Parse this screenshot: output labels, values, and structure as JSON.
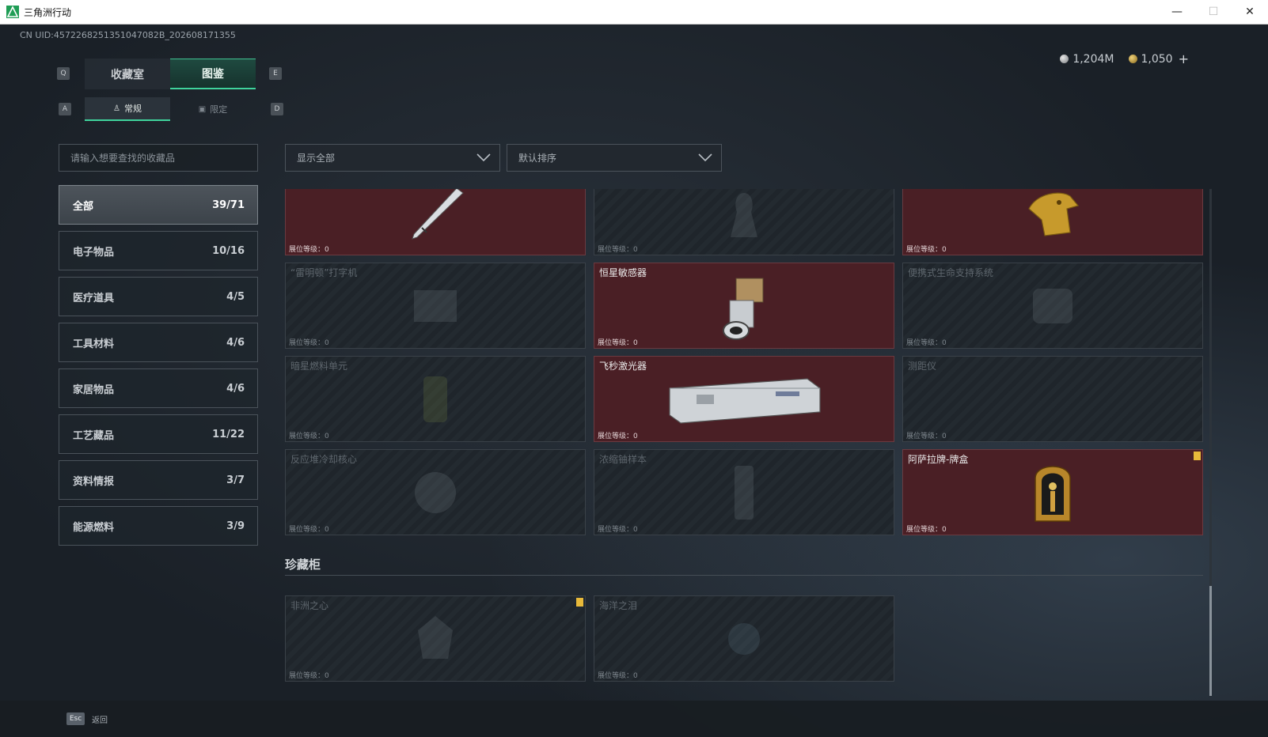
{
  "window": {
    "title": "三角洲行动",
    "minimize": "—",
    "maximize": "☐",
    "close": "✕"
  },
  "uid": "CN UID:4572268251351047082B_202608171355",
  "currency": {
    "silver": "1,204M",
    "gold": "1,050",
    "plus": "+"
  },
  "keys": {
    "q": "Q",
    "e": "E",
    "a": "A",
    "d": "D",
    "esc": "Esc"
  },
  "main_tabs": [
    "收藏室",
    "图鉴"
  ],
  "sub_tabs": [
    "常规",
    "限定"
  ],
  "search": {
    "placeholder": "请输入想要查找的收藏品"
  },
  "filter": {
    "show": "显示全部",
    "sort": "默认排序"
  },
  "categories": [
    {
      "label": "全部",
      "count": "39/71"
    },
    {
      "label": "电子物品",
      "count": "10/16"
    },
    {
      "label": "医疗道具",
      "count": "4/5"
    },
    {
      "label": "工具材料",
      "count": "4/6"
    },
    {
      "label": "家居物品",
      "count": "4/6"
    },
    {
      "label": "工艺藏品",
      "count": "11/22"
    },
    {
      "label": "资料情报",
      "count": "3/7"
    },
    {
      "label": "能源燃料",
      "count": "3/9"
    }
  ],
  "level_label": "展位等级：0",
  "cards": [
    {
      "name": "",
      "owned": true,
      "icon": "pen-icon"
    },
    {
      "name": "",
      "owned": false,
      "icon": "bust-icon"
    },
    {
      "name": "",
      "owned": true,
      "icon": "golden-dragon-icon"
    },
    {
      "name": "“雷明顿”打字机",
      "owned": false,
      "icon": "typewriter-icon"
    },
    {
      "name": "恒星敏感器",
      "owned": true,
      "icon": "star-sensor-icon"
    },
    {
      "name": "便携式生命支持系统",
      "owned": false,
      "icon": "life-support-icon"
    },
    {
      "name": "暗星燃料单元",
      "owned": false,
      "icon": "fuel-cell-icon"
    },
    {
      "name": "飞秒激光器",
      "owned": true,
      "icon": "laser-case-icon"
    },
    {
      "name": "测距仪",
      "owned": false,
      "icon": "rangefinder-icon"
    },
    {
      "name": "反应堆冷却核心",
      "owned": false,
      "icon": "reactor-core-icon"
    },
    {
      "name": "浓缩铀样本",
      "owned": false,
      "icon": "uranium-icon"
    },
    {
      "name": "阿萨拉牌-牌盒",
      "owned": true,
      "icon": "card-box-icon",
      "flag": true
    }
  ],
  "treasure": {
    "title": "珍藏柜",
    "cards": [
      {
        "name": "非洲之心",
        "owned": false,
        "icon": "africa-heart-icon",
        "flag": true
      },
      {
        "name": "海洋之泪",
        "owned": false,
        "icon": "ocean-tear-icon"
      }
    ]
  },
  "footer": {
    "back": "返回"
  }
}
